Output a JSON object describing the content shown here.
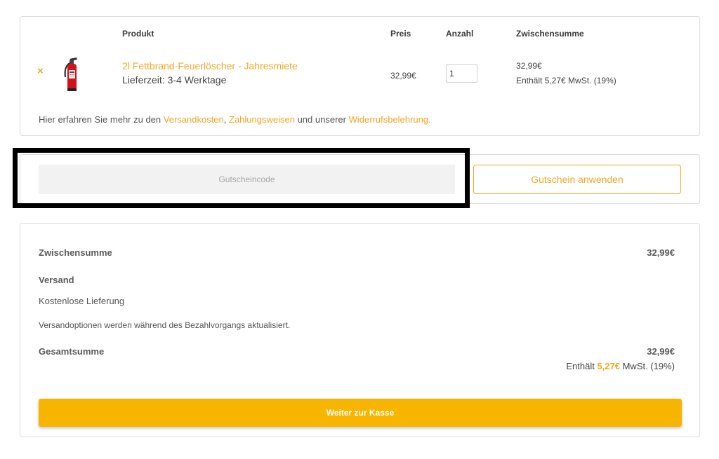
{
  "cart": {
    "headers": {
      "product": "Produkt",
      "price": "Preis",
      "quantity": "Anzahl",
      "subtotal": "Zwischensumme"
    },
    "item": {
      "remove_symbol": "×",
      "name": "2l Fettbrand-Feuerlöscher - Jahresmiete",
      "delivery": "Lieferzeit: 3-4 Werktage",
      "price": "32,99€",
      "quantity": "1",
      "subtotal": "32,99€",
      "subtotal_vat": "Enthält 5,27€ MwSt. (19%)"
    },
    "info": {
      "prefix": "Hier erfahren Sie mehr zu den ",
      "link_shipping": "Versandkosten",
      "sep": ", ",
      "link_payment": "Zahlungsweisen",
      "middle": " und unserer ",
      "link_withdrawal": "Widerrufsbelehrung",
      "suffix": "."
    }
  },
  "coupon": {
    "placeholder": "Gutscheincode",
    "button_label": "Gutschein anwenden"
  },
  "totals": {
    "subtotal_label": "Zwischensumme",
    "subtotal_value": "32,99€",
    "shipping_label": "Versand",
    "shipping_method": "Kostenlose Lieferung",
    "shipping_note": "Versandoptionen werden während des Bezahlvorgangs aktualisiert.",
    "total_label": "Gesamtsumme",
    "total_value": "32,99€",
    "vat_prefix": "Enthält ",
    "vat_amount": "5,27€",
    "vat_suffix": " MwSt. (19%)",
    "checkout_label": "Weiter zur Kasse"
  },
  "colors": {
    "accent": "#f5a623",
    "checkout_bg": "#f7b500",
    "highlight_border": "#000000"
  },
  "icons": {
    "remove": "close-icon",
    "product": "fire-extinguisher-icon"
  }
}
